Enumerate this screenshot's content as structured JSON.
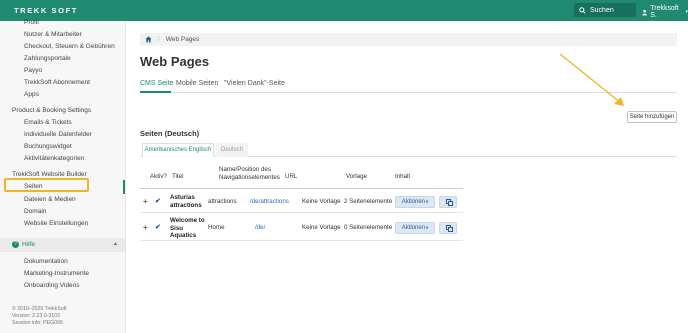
{
  "topbar": {
    "logo_text": "TREKK  SOFT",
    "search_placeholder": "Suchen",
    "user_label": "Trekksoft S.",
    "brand_color": "#1f8a70"
  },
  "sidebar": {
    "items_top": [
      "Profil",
      "Nutzer & Mitarbeiter",
      "Checkout, Steuern & Gebühren",
      "Zahlungsportale",
      "Payyo",
      "TrekkSoft Abonnement",
      "Apps"
    ],
    "section_booking": "Product & Booking Settings",
    "items_booking": [
      "Emails & Tickets",
      "Individuelle Datenfelder",
      "Buchungswidget",
      "Aktivitätenkategorien"
    ],
    "section_website": "TrekkSoft Website Builder",
    "items_website": [
      "Seiten",
      "Dateien & Medien",
      "Domain",
      "Website Einstellungen"
    ],
    "active_item": "Seiten",
    "highlight_color": "#f0b429",
    "help_label": "Hilfe",
    "help_items": [
      "Dokumentation",
      "Marketing-Instrumente",
      "Onboarding Videos"
    ],
    "footer": [
      "© 2010–2025 TrekkSoft",
      "Version: 2.23.0-3103",
      "Session info: PEG099"
    ]
  },
  "breadcrumb": {
    "label": "Web Pages"
  },
  "page_title": "Web Pages",
  "tabs": [
    "CMS Seite",
    "Mobile Seiten",
    "\"Vielen Dank\"-Seite"
  ],
  "add_page_button": "Seite hinzufügen",
  "section_title": "Seiten (Deutsch)",
  "lang_tabs": [
    "Amerikanisches Englisch",
    "Deutsch"
  ],
  "table": {
    "headers": {
      "aktiv": "Aktiv?",
      "titel": "Titel",
      "name_nav": "Name/Position des Navigationselementes",
      "url": "URL",
      "vorlage": "Vorlage",
      "inhalt": "Inhalt"
    },
    "rows": [
      {
        "titel": "Asturias attractions",
        "name_nav": "attractions",
        "url": "/de/attractions",
        "vorlage": "Keine Vorlage",
        "inhalt": "2 Seitenelemente",
        "actions_label": "Aktionen"
      },
      {
        "titel": "Welcome to Sisu Aquatics",
        "name_nav": "Home",
        "url": "/de/",
        "vorlage": "Keine Vorlage",
        "inhalt": "0 Seitenelemente",
        "actions_label": "Aktionen"
      }
    ]
  },
  "annotation_arrow_color": "#f0b429"
}
